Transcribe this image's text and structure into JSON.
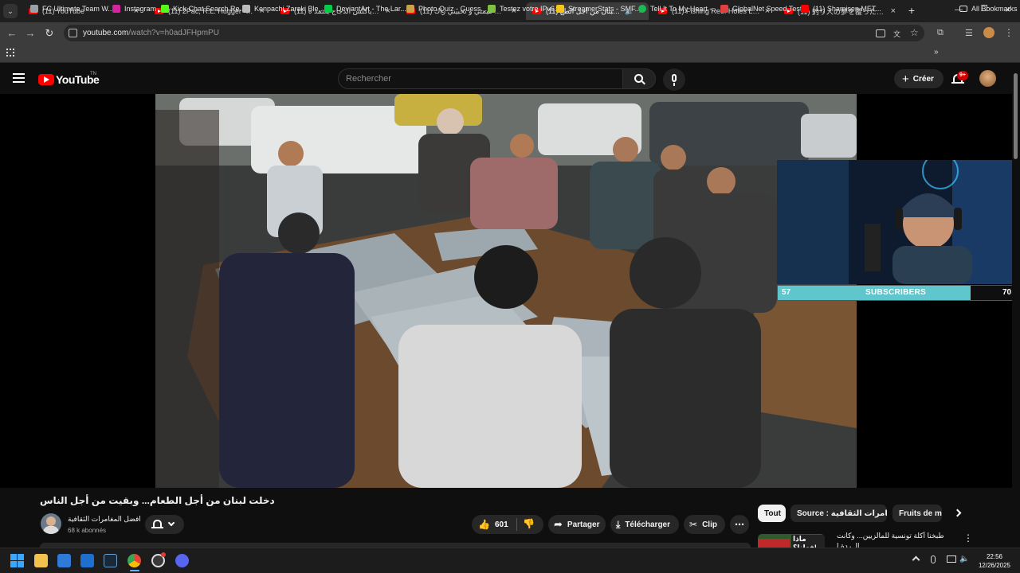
{
  "browser": {
    "tabs": [
      {
        "title": "(11) YouTube",
        "active": false,
        "muted": false
      },
      {
        "title": "(11) 2Pac, R.L. Hugger - Until Th",
        "active": false,
        "muted": false
      },
      {
        "title": "(11) اللي مايأكلش الدجاج يعتمد ه",
        "active": false,
        "muted": false
      },
      {
        "title": "(11) كان جيت ميمتي و تحبيني زاك",
        "active": false,
        "muted": false
      },
      {
        "title": "(11) دخلت لبنان من أجل الطع",
        "active": true,
        "muted": false
      },
      {
        "title": "(11) Fishing Reef Holes LOADE",
        "active": false,
        "muted": false
      },
      {
        "title": "(11) 釣り人の夢を覆った！堤防か",
        "active": false,
        "muted": false
      }
    ],
    "new_tab": "+",
    "url_host": "youtube.com",
    "url_path": "/watch?v=h0adJFHpmPU",
    "bookmarks": [
      {
        "label": "FC Ultimate Team W...",
        "color": "#9aa0a6"
      },
      {
        "label": "Instagram",
        "color": "#d6249f"
      },
      {
        "label": "Kick Chat Search Re...",
        "color": "#53fc18"
      },
      {
        "label": "Kenpachi Zaraki Ble...",
        "color": "#bbbbbb"
      },
      {
        "label": "DeviantArt - The Lar...",
        "color": "#05cc47"
      },
      {
        "label": "Photo Quiz - Guess...",
        "color": "#c9a24a"
      },
      {
        "label": "Testez votre IPv6.",
        "color": "#7dc242"
      },
      {
        "label": "StreamerStats - SMF...",
        "color": "#f5c518"
      },
      {
        "label": "Tell It To My Heart -...",
        "color": "#1db954"
      },
      {
        "label": "GlobalNet Speed Test",
        "color": "#e04040"
      },
      {
        "label": "(11) Shamisen MET...",
        "color": "#ff0000"
      }
    ],
    "all_bookmarks": "All Bookmarks"
  },
  "youtube": {
    "logo_text": "YouTube",
    "logo_sup": "TN",
    "search_placeholder": "Rechercher",
    "create_label": "Créer",
    "notif_badge": "9+",
    "overlay": {
      "sub_start": "57",
      "sub_label": "SUBSCRIBERS",
      "sub_goal": "70",
      "progress_fraction": 0.81
    },
    "video_title": "دخلت لبنان من أجل الطعام... وبقيت من أجل الناس",
    "channel_name": "افضل المغامرات الثقافية",
    "channel_subs": "68 k abonnés",
    "likes": "601",
    "share_label": "Partager",
    "download_label": "Télécharger",
    "clip_label": "Clip",
    "chips": [
      "Tout",
      "Source : افضل المغامرات الثقافية",
      "Fruits de mer"
    ],
    "rec_title": "طبخنا أكلة تونسية للمالزيين... وكانت",
    "rec_title2": "الـ ردة ا",
    "rec_thumb_text": "ماذا فعلنا؟!"
  },
  "taskbar": {
    "time": "22:56",
    "date": "12/26/2025"
  }
}
